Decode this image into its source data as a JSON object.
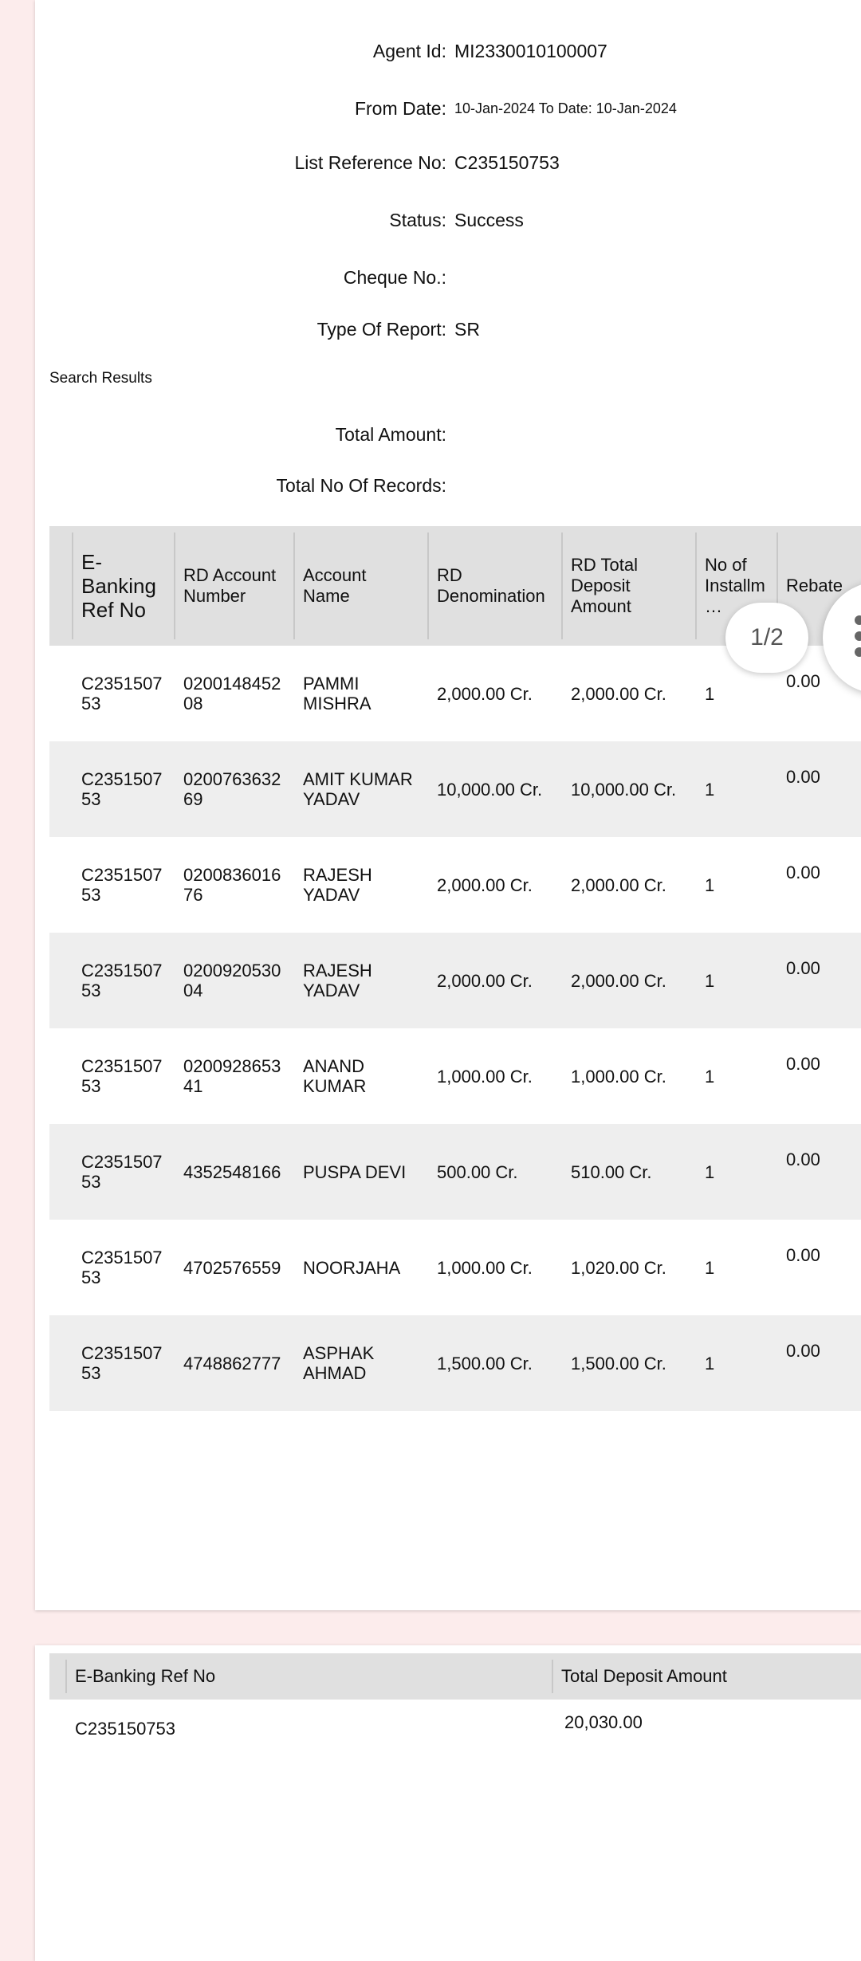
{
  "report": {
    "agent_id_label": "Agent Id:",
    "agent_id": "MI2330010100007",
    "from_date_label": "From Date:",
    "from_date_value": "10-Jan-2024 To Date: 10-Jan-2024",
    "list_ref_label": "List Reference No:",
    "list_ref": "C235150753",
    "status_label": "Status:",
    "status": "Success",
    "cheque_label": "Cheque No.:",
    "cheque": "",
    "type_label": "Type Of Report:",
    "type": "SR",
    "search_results": "Search Results",
    "total_amount_label": "Total Amount:",
    "total_amount": "",
    "total_records_label": "Total No Of Records:",
    "total_records": ""
  },
  "table": {
    "headers": [
      "E-\nBanking\nRef No",
      "RD Account\nNumber",
      "Account\nName",
      "RD\nDenomination",
      "RD Total\nDeposit\nAmount",
      "No of\nInstallm\n…",
      "Rebate"
    ],
    "rows": [
      {
        "ref": "C2351507\n53",
        "account": "0200148452\n08",
        "name": "PAMMI\nMISHRA",
        "denomination": "2,000.00 Cr.",
        "deposit": "2,000.00 Cr.",
        "installments": "1",
        "rebate": "0.00"
      },
      {
        "ref": "C2351507\n53",
        "account": "0200763632\n69",
        "name": "AMIT KUMAR\nYADAV",
        "denomination": "10,000.00 Cr.",
        "deposit": "10,000.00 Cr.",
        "installments": "1",
        "rebate": "0.00"
      },
      {
        "ref": "C2351507\n53",
        "account": "0200836016\n76",
        "name": "RAJESH\nYADAV",
        "denomination": "2,000.00 Cr.",
        "deposit": "2,000.00 Cr.",
        "installments": "1",
        "rebate": "0.00"
      },
      {
        "ref": "C2351507\n53",
        "account": "0200920530\n04",
        "name": "RAJESH\nYADAV",
        "denomination": "2,000.00 Cr.",
        "deposit": "2,000.00 Cr.",
        "installments": "1",
        "rebate": "0.00"
      },
      {
        "ref": "C2351507\n53",
        "account": "0200928653\n41",
        "name": "ANAND\nKUMAR",
        "denomination": "1,000.00 Cr.",
        "deposit": "1,000.00 Cr.",
        "installments": "1",
        "rebate": "0.00"
      },
      {
        "ref": "C2351507\n53",
        "account": "4352548166",
        "name": "PUSPA DEVI",
        "denomination": "500.00 Cr.",
        "deposit": "510.00 Cr.",
        "installments": "1",
        "rebate": "0.00"
      },
      {
        "ref": "C2351507\n53",
        "account": "4702576559",
        "name": "NOORJAHA",
        "denomination": "1,000.00 Cr.",
        "deposit": "1,020.00 Cr.",
        "installments": "1",
        "rebate": "0.00"
      },
      {
        "ref": "C2351507\n53",
        "account": "4748862777",
        "name": "ASPHAK\nAHMAD",
        "denomination": "1,500.00 Cr.",
        "deposit": "1,500.00 Cr.",
        "installments": "1",
        "rebate": "0.00"
      }
    ]
  },
  "pager": {
    "label": "1/2"
  },
  "summary": {
    "headers": [
      "E-Banking Ref No",
      "Total Deposit Amount"
    ],
    "ref": "C235150753",
    "total": "20,030.00"
  },
  "fab_icon": "grid-dots-icon"
}
